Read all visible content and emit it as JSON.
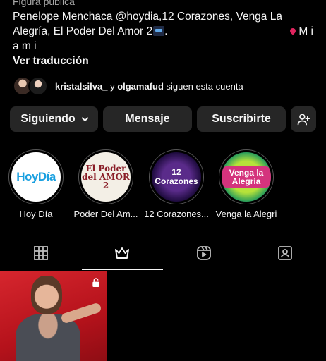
{
  "profile": {
    "category": "Figura pública",
    "bio_line1": "Penelope Menchaca @hoydia,12 Corazones, Venga La",
    "bio_line2": "Alegría, El Poder Del Amor 2",
    "bio_location": "M i",
    "bio_line3": "a m i",
    "translate_label": "Ver traducción",
    "followed_user1": "kristalsilva_",
    "followed_connector": " y ",
    "followed_user2": "olgamafud",
    "followed_suffix": " siguen esta cuenta"
  },
  "actions": {
    "following_label": "Siguiendo",
    "message_label": "Mensaje",
    "subscribe_label": "Suscribirte",
    "add_icon": "person-add-icon"
  },
  "highlights": [
    {
      "label": "Hoy Día",
      "cover_text": "HoyDía"
    },
    {
      "label": "Poder Del Am...",
      "cover_text": "El Poder del AMOR 2"
    },
    {
      "label": "12 Corazones...",
      "cover_text": "12 Corazones"
    },
    {
      "label": "Venga la Alegri",
      "cover_text": "Venga la Alegría"
    }
  ],
  "tabs": [
    {
      "icon": "grid-icon",
      "active": false
    },
    {
      "icon": "crown-icon",
      "active": true
    },
    {
      "icon": "reels-icon",
      "active": false
    },
    {
      "icon": "tagged-icon",
      "active": false
    }
  ],
  "colors": {
    "background": "#000000",
    "button_bg": "#262626",
    "text": "#f5f5f5",
    "muted": "#a8a8a8"
  }
}
